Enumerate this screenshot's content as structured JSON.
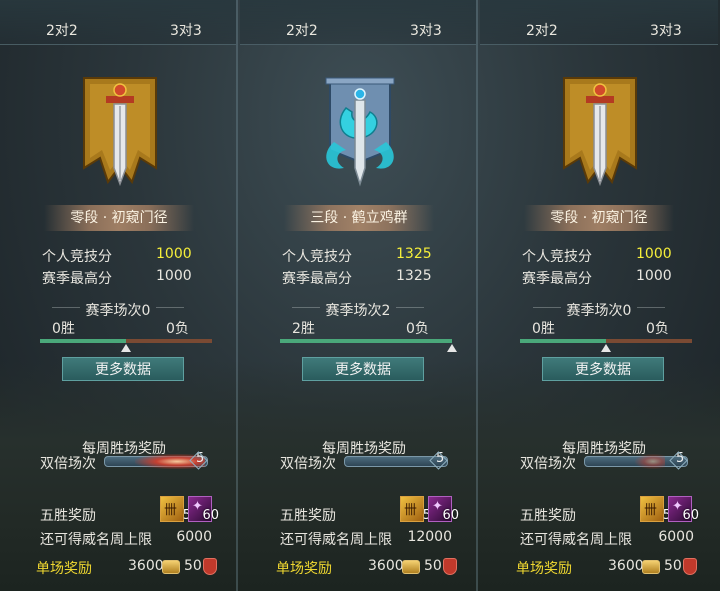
{
  "tabs": {
    "t1": "2对2",
    "t2": "3对3"
  },
  "labels": {
    "personal_score": "个人竞技分",
    "season_high": "赛季最高分",
    "more_data": "更多数据",
    "weekly_reward": "每周胜场奖励",
    "double_matches": "双倍场次",
    "five_win_reward": "五胜奖励",
    "remaining_limit": "还可得威名周上限",
    "single_reward": "单场奖励"
  },
  "panels": [
    {
      "rank": "零段 · 初窥门径",
      "emblem": "sword-banner-gold",
      "score": "1000",
      "high": "1000",
      "season_count": "赛季场次0",
      "wins": "0胜",
      "losses": "0负",
      "win_ratio": 0.5,
      "double_count": "5",
      "item1_count": "5",
      "item2_count": "60",
      "limit": "6000",
      "single_coin": "3600",
      "single_shield": "50"
    },
    {
      "rank": "三段 · 鹤立鸡群",
      "emblem": "sword-banner-dragon",
      "score": "1325",
      "high": "1325",
      "season_count": "赛季场次2",
      "wins": "2胜",
      "losses": "0负",
      "win_ratio": 1.0,
      "double_count": "5",
      "item1_count": "5",
      "item2_count": "60",
      "limit": "12000",
      "single_coin": "3600",
      "single_shield": "50"
    },
    {
      "rank": "零段 · 初窥门径",
      "emblem": "sword-banner-gold",
      "score": "1000",
      "high": "1000",
      "season_count": "赛季场次0",
      "wins": "0胜",
      "losses": "0负",
      "win_ratio": 0.5,
      "double_count": "5",
      "item1_count": "5",
      "item2_count": "60",
      "limit": "6000",
      "single_coin": "3600",
      "single_shield": "50"
    }
  ],
  "colors": {
    "highlight_score": "#f5ee3a",
    "single_reward_label": "#f0d830"
  }
}
